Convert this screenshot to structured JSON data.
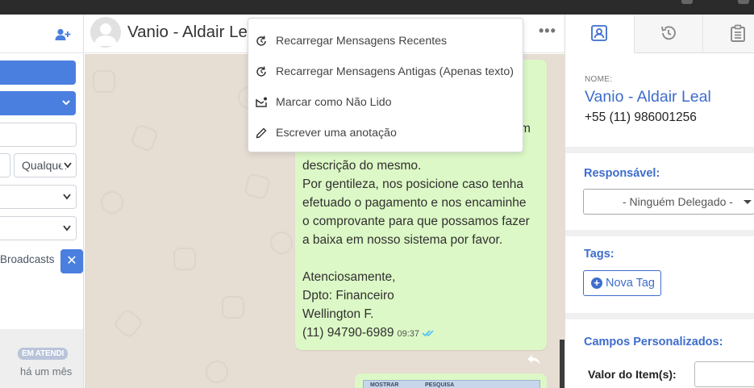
{
  "left_panel": {
    "qualquer_select": "Qualquer",
    "broadcasts_label": "Broadcasts",
    "clear_label": "✕",
    "conversation": {
      "badge": "EM ATENDI",
      "time": "há um mês"
    }
  },
  "chat": {
    "contact_name": "Vanio - Aldair Leal",
    "menu_dots": "•••",
    "message_lines": [
      "m",
      "descrição do mesmo.",
      "Por gentileza, nos posicione caso tenha",
      "efetuado o pagamento e nos encaminhe",
      "o comprovante para que possamos fazer",
      "a baixa em nosso sistema por favor.",
      "Atenciosamente,",
      "Dpto: Financeiro",
      "Wellington F.",
      "(11) 94790-6989"
    ],
    "message_time": "09:37",
    "image_labels": [
      "MOSTRAR",
      "PESQUISA"
    ]
  },
  "context_menu": {
    "items": [
      {
        "label": "Recarregar Mensagens Recentes",
        "icon": "reload-icon"
      },
      {
        "label": "Recarregar Mensagens Antigas (Apenas texto)",
        "icon": "reload-icon"
      },
      {
        "label": "Marcar como Não Lido",
        "icon": "mark-unread-icon"
      },
      {
        "label": "Escrever uma anotação",
        "icon": "pencil-icon"
      }
    ]
  },
  "right_panel": {
    "tabs": [
      "contact-icon",
      "history-icon",
      "clipboard-icon"
    ],
    "nome_label": "NOME:",
    "name": "Vanio - Aldair Leal",
    "phone": "+55 (11) 986001256",
    "responsavel_title": "Responsável:",
    "responsavel_value": "- Ninguém Delegado -",
    "tags_title": "Tags:",
    "new_tag_label": "Nova Tag",
    "custom_fields_title": "Campos Personalizados:",
    "valor_label": "Valor do Item(s):",
    "valor_value": ""
  },
  "colors": {
    "accent": "#4a7fe0",
    "link_blue": "#3e6dcc",
    "bubble": "#dcf8c6",
    "chat_bg": "#e6ddd3"
  }
}
